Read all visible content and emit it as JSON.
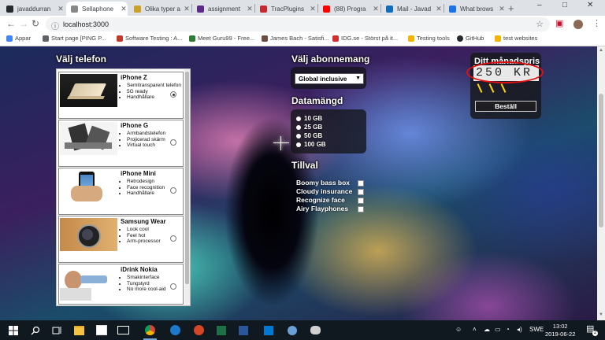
{
  "browser": {
    "tabs": [
      {
        "title": "javaddurran",
        "icon_color": "#24292e"
      },
      {
        "title": "Sellaphone",
        "icon_color": "#888888",
        "active": true
      },
      {
        "title": "Olika typer a",
        "icon_color": "#c9a227"
      },
      {
        "title": "assignment",
        "icon_color": "#5b2a86"
      },
      {
        "title": "TracPlugins",
        "icon_color": "#c6282e"
      },
      {
        "title": "(88) Progra",
        "icon_color": "#ff0000"
      },
      {
        "title": "Mail - Javad",
        "icon_color": "#0f6cbd"
      },
      {
        "title": "What brows",
        "icon_color": "#1a73e8"
      }
    ],
    "new_tab": "+",
    "window_controls": [
      "–",
      "□",
      "✕"
    ],
    "url": "localhost:3000",
    "bookmarks": [
      {
        "label": "Appar",
        "icon_color": "#4285f4"
      },
      {
        "label": "Start page [PING P...",
        "icon_color": "#5f6368"
      },
      {
        "label": "Software Testing : A...",
        "icon_color": "#c0392b"
      },
      {
        "label": "Meet Guru99 - Free...",
        "icon_color": "#2e7d32"
      },
      {
        "label": "James Bach - Satisfi...",
        "icon_color": "#6d4c41"
      },
      {
        "label": "IDG.se - Störst på it...",
        "icon_color": "#d32f2f"
      },
      {
        "label": "Testing tools",
        "icon_color": "#f4b400"
      },
      {
        "label": "GitHub",
        "icon_color": "#24292e"
      },
      {
        "label": "test websites",
        "icon_color": "#f4b400"
      }
    ]
  },
  "page": {
    "phones_heading": "Välj telefon",
    "phones": [
      {
        "name": "iPhone Z",
        "features": [
          "Semitransparent telefon",
          "5G ready",
          "Handhållare"
        ],
        "selected": true,
        "image": "laptop-like-phone"
      },
      {
        "name": "iPhone G",
        "features": [
          "Armbandstelefon",
          "Projicerad skärm",
          "Virtual touch"
        ],
        "selected": false,
        "image": "gadgets"
      },
      {
        "name": "iPhone Mini",
        "features": [
          "Retrodesign",
          "Face recognition",
          "Handhållare"
        ],
        "selected": false,
        "image": "hand-holding-phone"
      },
      {
        "name": "Samsung Wear",
        "features": [
          "Look cool",
          "Feel hot",
          "Arm-processor"
        ],
        "selected": false,
        "image": "smartwatch"
      },
      {
        "name": "iDrink Nokia",
        "features": [
          "Smakinterface",
          "Tungstyrd",
          "No more cool-aid"
        ],
        "selected": false,
        "image": "man-drinking"
      }
    ],
    "subscription_heading": "Välj abonnemang",
    "subscription_value": "Global inclusive",
    "data_heading": "Datamängd",
    "data_options": [
      "10 GB",
      "25 GB",
      "50 GB",
      "100 GB"
    ],
    "addons_heading": "Tillval",
    "addons": [
      "Boomy bass box",
      "Cloudy insurance",
      "Recognize face",
      "Airy Flayphones"
    ],
    "price_heading": "Ditt månadspris",
    "price_value": "250 KR",
    "order_button": "Beställ"
  },
  "taskbar": {
    "language": "SWE",
    "time": "13:02",
    "date": "2019-06-22",
    "notification_count": "2"
  }
}
